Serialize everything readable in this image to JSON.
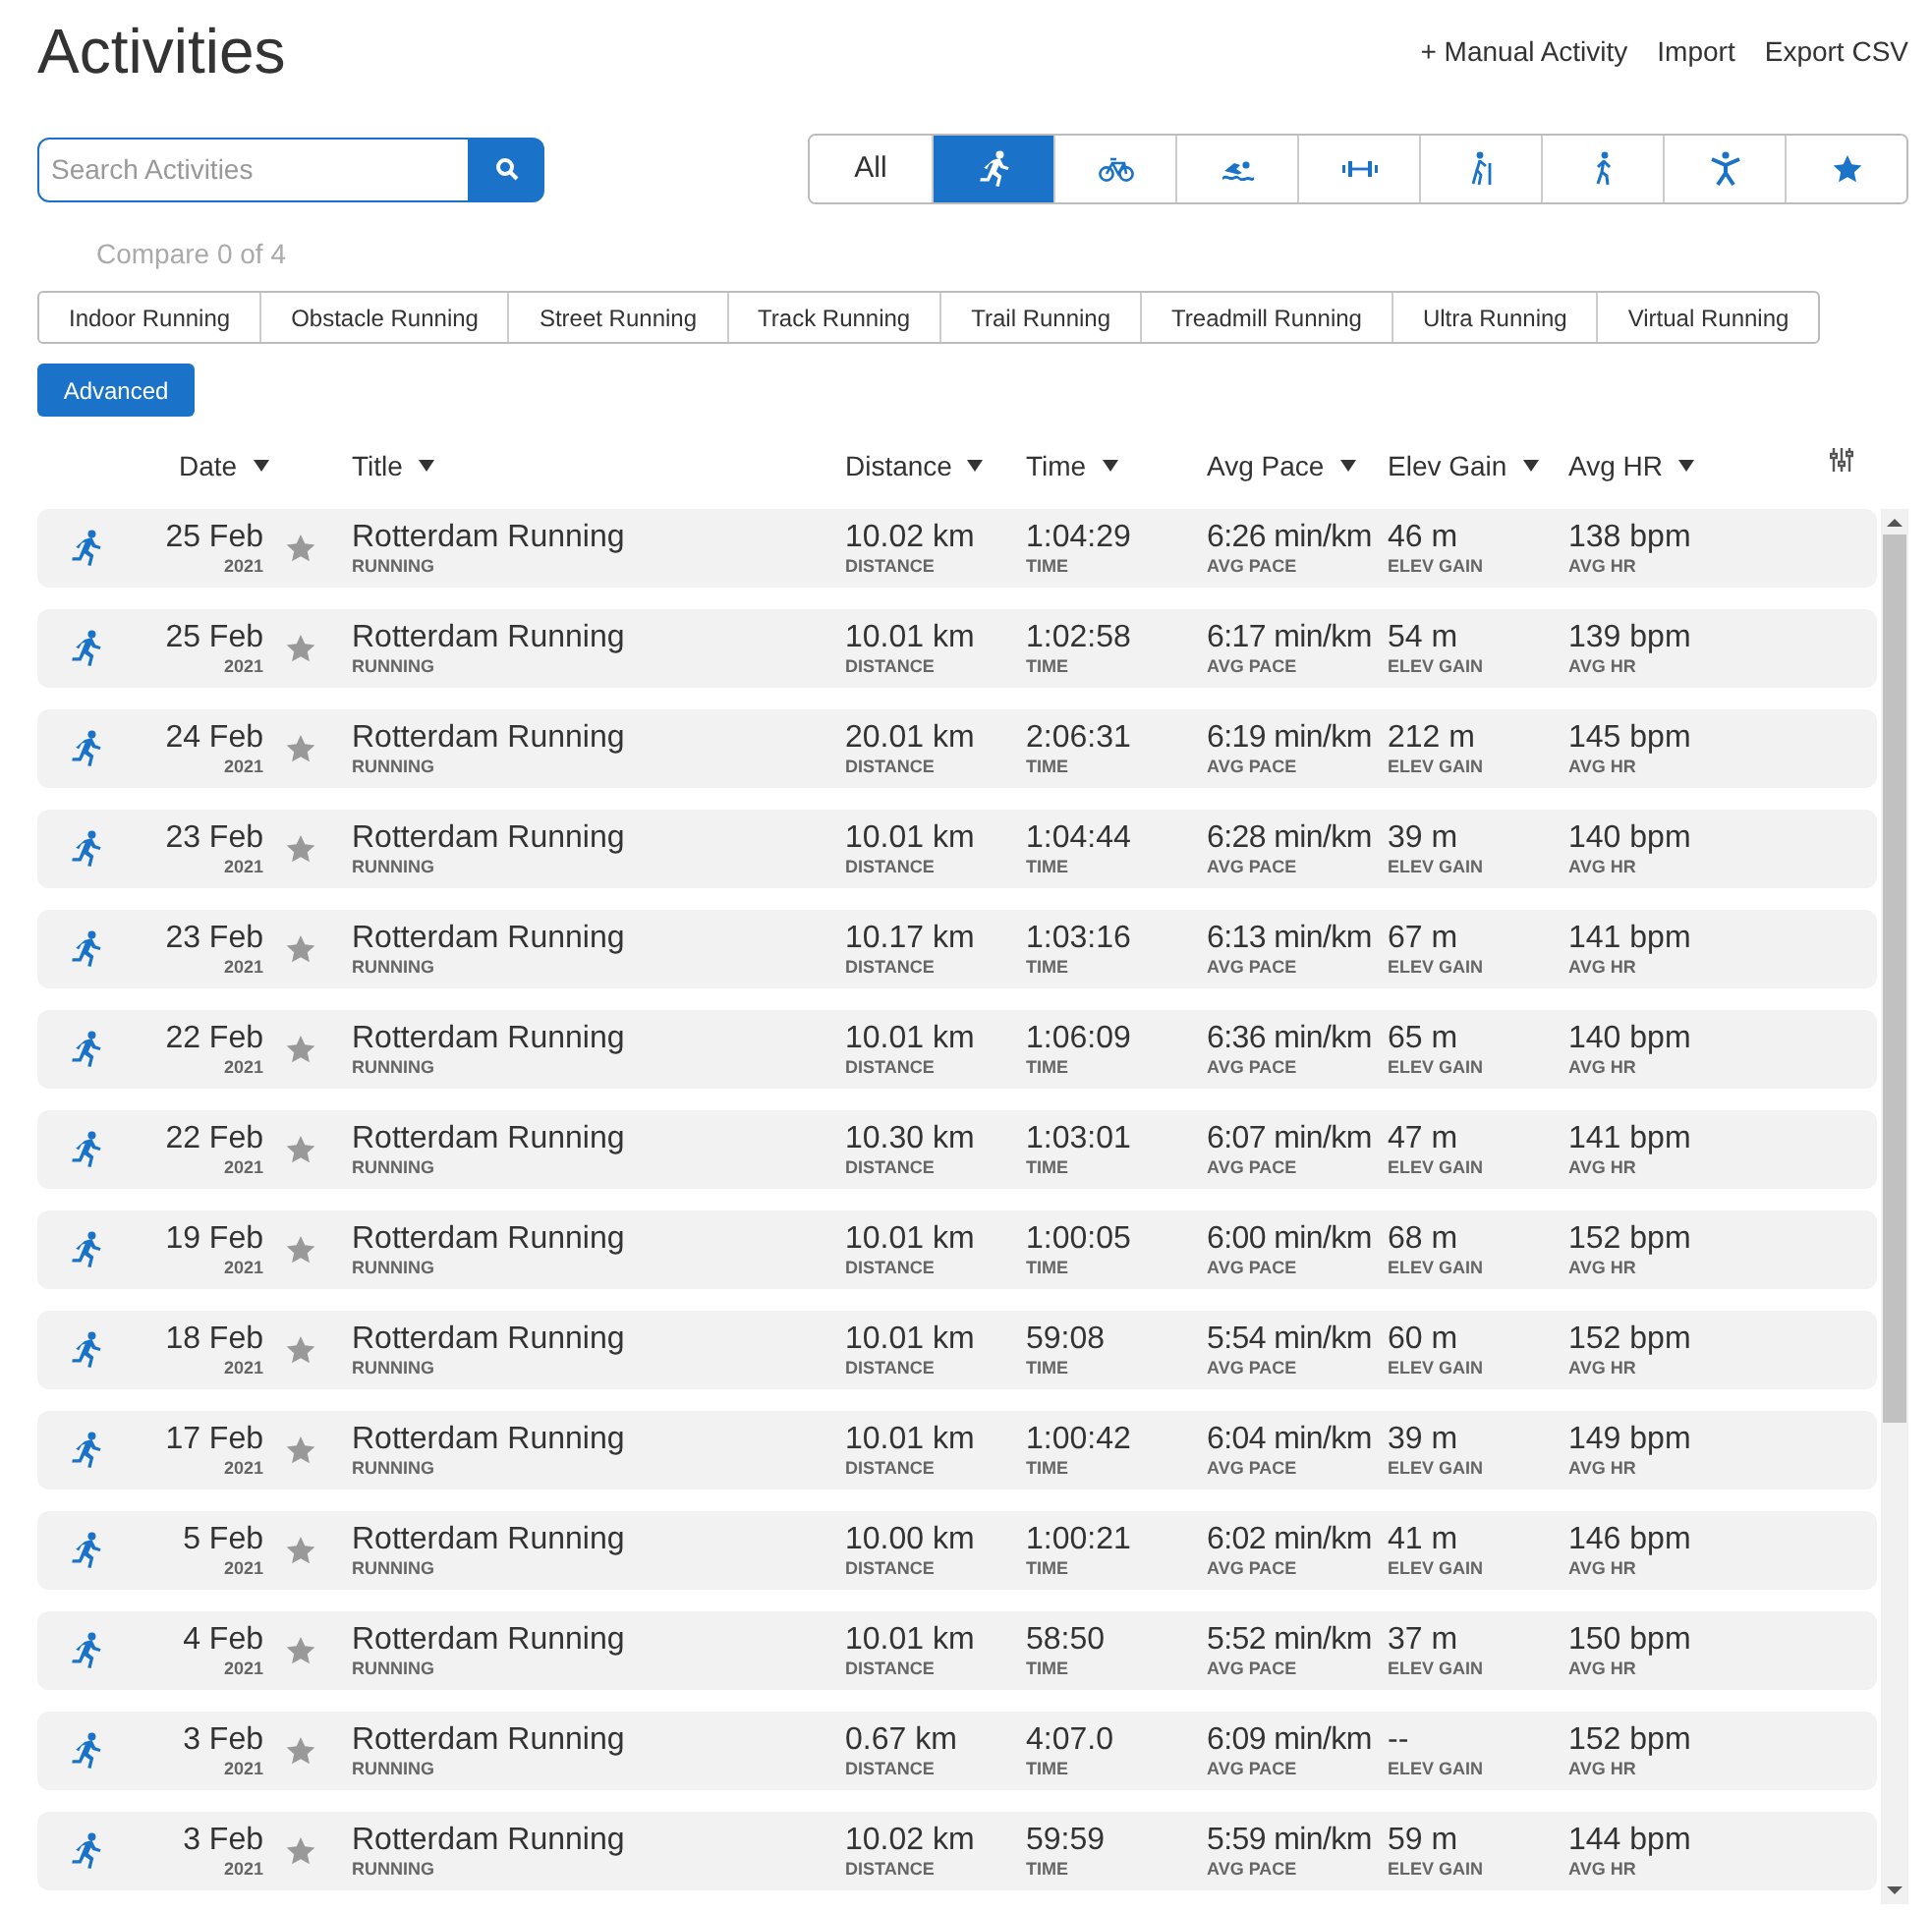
{
  "page_title": "Activities",
  "header_links": [
    "+ Manual Activity",
    "Import",
    "Export CSV"
  ],
  "search": {
    "placeholder": "Search Activities"
  },
  "type_filters": [
    {
      "kind": "all",
      "label": "All",
      "selected": false
    },
    {
      "kind": "running",
      "selected": true
    },
    {
      "kind": "cycling",
      "selected": false
    },
    {
      "kind": "swimming",
      "selected": false
    },
    {
      "kind": "strength",
      "selected": false
    },
    {
      "kind": "hiking",
      "selected": false
    },
    {
      "kind": "walking",
      "selected": false
    },
    {
      "kind": "fitness",
      "selected": false
    },
    {
      "kind": "favorites",
      "selected": false
    }
  ],
  "compare": "Compare 0 of 4",
  "subtypes": [
    "Indoor Running",
    "Obstacle Running",
    "Street Running",
    "Track Running",
    "Trail Running",
    "Treadmill Running",
    "Ultra Running",
    "Virtual Running"
  ],
  "advanced_button": "Advanced",
  "columns": [
    "Date",
    "Title",
    "Distance",
    "Time",
    "Avg Pace",
    "Elev Gain",
    "Avg HR"
  ],
  "rows": [
    {
      "date": "25 Feb",
      "year": "2021",
      "favorite": false,
      "title": "Rotterdam Running",
      "type": "RUNNING",
      "distance": "10.02 km",
      "distance_label": "DISTANCE",
      "time": "1:04:29",
      "time_label": "TIME",
      "pace": "6:26 min/km",
      "pace_label": "AVG PACE",
      "elev": "46 m",
      "elev_label": "ELEV GAIN",
      "hr": "138 bpm",
      "hr_label": "AVG HR"
    },
    {
      "date": "25 Feb",
      "year": "2021",
      "favorite": false,
      "title": "Rotterdam Running",
      "type": "RUNNING",
      "distance": "10.01 km",
      "distance_label": "DISTANCE",
      "time": "1:02:58",
      "time_label": "TIME",
      "pace": "6:17 min/km",
      "pace_label": "AVG PACE",
      "elev": "54 m",
      "elev_label": "ELEV GAIN",
      "hr": "139 bpm",
      "hr_label": "AVG HR"
    },
    {
      "date": "24 Feb",
      "year": "2021",
      "favorite": false,
      "title": "Rotterdam Running",
      "type": "RUNNING",
      "distance": "20.01 km",
      "distance_label": "DISTANCE",
      "time": "2:06:31",
      "time_label": "TIME",
      "pace": "6:19 min/km",
      "pace_label": "AVG PACE",
      "elev": "212 m",
      "elev_label": "ELEV GAIN",
      "hr": "145 bpm",
      "hr_label": "AVG HR"
    },
    {
      "date": "23 Feb",
      "year": "2021",
      "favorite": false,
      "title": "Rotterdam Running",
      "type": "RUNNING",
      "distance": "10.01 km",
      "distance_label": "DISTANCE",
      "time": "1:04:44",
      "time_label": "TIME",
      "pace": "6:28 min/km",
      "pace_label": "AVG PACE",
      "elev": "39 m",
      "elev_label": "ELEV GAIN",
      "hr": "140 bpm",
      "hr_label": "AVG HR"
    },
    {
      "date": "23 Feb",
      "year": "2021",
      "favorite": false,
      "title": "Rotterdam Running",
      "type": "RUNNING",
      "distance": "10.17 km",
      "distance_label": "DISTANCE",
      "time": "1:03:16",
      "time_label": "TIME",
      "pace": "6:13 min/km",
      "pace_label": "AVG PACE",
      "elev": "67 m",
      "elev_label": "ELEV GAIN",
      "hr": "141 bpm",
      "hr_label": "AVG HR"
    },
    {
      "date": "22 Feb",
      "year": "2021",
      "favorite": false,
      "title": "Rotterdam Running",
      "type": "RUNNING",
      "distance": "10.01 km",
      "distance_label": "DISTANCE",
      "time": "1:06:09",
      "time_label": "TIME",
      "pace": "6:36 min/km",
      "pace_label": "AVG PACE",
      "elev": "65 m",
      "elev_label": "ELEV GAIN",
      "hr": "140 bpm",
      "hr_label": "AVG HR"
    },
    {
      "date": "22 Feb",
      "year": "2021",
      "favorite": false,
      "title": "Rotterdam Running",
      "type": "RUNNING",
      "distance": "10.30 km",
      "distance_label": "DISTANCE",
      "time": "1:03:01",
      "time_label": "TIME",
      "pace": "6:07 min/km",
      "pace_label": "AVG PACE",
      "elev": "47 m",
      "elev_label": "ELEV GAIN",
      "hr": "141 bpm",
      "hr_label": "AVG HR"
    },
    {
      "date": "19 Feb",
      "year": "2021",
      "favorite": false,
      "title": "Rotterdam Running",
      "type": "RUNNING",
      "distance": "10.01 km",
      "distance_label": "DISTANCE",
      "time": "1:00:05",
      "time_label": "TIME",
      "pace": "6:00 min/km",
      "pace_label": "AVG PACE",
      "elev": "68 m",
      "elev_label": "ELEV GAIN",
      "hr": "152 bpm",
      "hr_label": "AVG HR"
    },
    {
      "date": "18 Feb",
      "year": "2021",
      "favorite": false,
      "title": "Rotterdam Running",
      "type": "RUNNING",
      "distance": "10.01 km",
      "distance_label": "DISTANCE",
      "time": "59:08",
      "time_label": "TIME",
      "pace": "5:54 min/km",
      "pace_label": "AVG PACE",
      "elev": "60 m",
      "elev_label": "ELEV GAIN",
      "hr": "152 bpm",
      "hr_label": "AVG HR"
    },
    {
      "date": "17 Feb",
      "year": "2021",
      "favorite": false,
      "title": "Rotterdam Running",
      "type": "RUNNING",
      "distance": "10.01 km",
      "distance_label": "DISTANCE",
      "time": "1:00:42",
      "time_label": "TIME",
      "pace": "6:04 min/km",
      "pace_label": "AVG PACE",
      "elev": "39 m",
      "elev_label": "ELEV GAIN",
      "hr": "149 bpm",
      "hr_label": "AVG HR"
    },
    {
      "date": "5 Feb",
      "year": "2021",
      "favorite": false,
      "title": "Rotterdam Running",
      "type": "RUNNING",
      "distance": "10.00 km",
      "distance_label": "DISTANCE",
      "time": "1:00:21",
      "time_label": "TIME",
      "pace": "6:02 min/km",
      "pace_label": "AVG PACE",
      "elev": "41 m",
      "elev_label": "ELEV GAIN",
      "hr": "146 bpm",
      "hr_label": "AVG HR"
    },
    {
      "date": "4 Feb",
      "year": "2021",
      "favorite": false,
      "title": "Rotterdam Running",
      "type": "RUNNING",
      "distance": "10.01 km",
      "distance_label": "DISTANCE",
      "time": "58:50",
      "time_label": "TIME",
      "pace": "5:52 min/km",
      "pace_label": "AVG PACE",
      "elev": "37 m",
      "elev_label": "ELEV GAIN",
      "hr": "150 bpm",
      "hr_label": "AVG HR"
    },
    {
      "date": "3 Feb",
      "year": "2021",
      "favorite": false,
      "title": "Rotterdam Running",
      "type": "RUNNING",
      "distance": "0.67 km",
      "distance_label": "DISTANCE",
      "time": "4:07.0",
      "time_label": "TIME",
      "pace": "6:09 min/km",
      "pace_label": "AVG PACE",
      "elev": "--",
      "elev_label": "ELEV GAIN",
      "hr": "152 bpm",
      "hr_label": "AVG HR"
    },
    {
      "date": "3 Feb",
      "year": "2021",
      "favorite": false,
      "title": "Rotterdam Running",
      "type": "RUNNING",
      "distance": "10.02 km",
      "distance_label": "DISTANCE",
      "time": "59:59",
      "time_label": "TIME",
      "pace": "5:59 min/km",
      "pace_label": "AVG PACE",
      "elev": "59 m",
      "elev_label": "ELEV GAIN",
      "hr": "144 bpm",
      "hr_label": "AVG HR"
    }
  ]
}
